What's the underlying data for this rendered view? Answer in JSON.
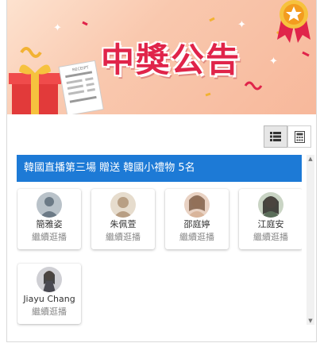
{
  "banner": {
    "title": "中獎公告",
    "receipt_label": "RECEIPT"
  },
  "toolbar": {
    "list_view_icon": "list-icon",
    "grid_view_icon": "calculator-icon"
  },
  "panel": {
    "header": "韓國直播第三場 贈送 韓國小禮物 5名"
  },
  "winners": [
    {
      "name": "簡雅姿",
      "action": "繼續逛播",
      "avatar_color": "#6c7a86"
    },
    {
      "name": "朱佩萱",
      "action": "繼續逛播",
      "avatar_color": "#b89f84"
    },
    {
      "name": "邵庭婷",
      "action": "繼續逛播",
      "avatar_color": "#7a5a44"
    },
    {
      "name": "江庭安",
      "action": "繼續逛播",
      "avatar_color": "#5b6e5a"
    },
    {
      "name": "Jiayu Chang",
      "action": "繼續逛播",
      "avatar_color": "#4a4a52"
    }
  ],
  "colors": {
    "header_blue": "#1d7ad6",
    "title_red": "#e0244a"
  }
}
